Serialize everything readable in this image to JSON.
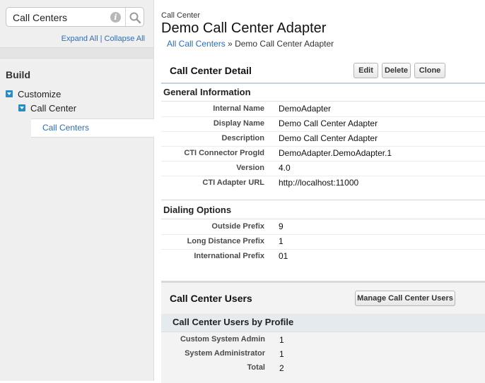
{
  "sidebar": {
    "search_value": "Call Centers",
    "expand_all": "Expand All",
    "separator": "|",
    "collapse_all": "Collapse All",
    "build_heading": "Build",
    "tree": {
      "customize": "Customize",
      "call_center": "Call Center",
      "call_centers": "Call Centers"
    }
  },
  "header": {
    "page_type": "Call Center",
    "title": "Demo Call Center Adapter",
    "breadcrumb_link": "All Call Centers",
    "breadcrumb_sep": "»",
    "breadcrumb_current": "Demo Call Center Adapter"
  },
  "detail": {
    "title": "Call Center Detail",
    "buttons": {
      "edit": "Edit",
      "delete": "Delete",
      "clone": "Clone"
    },
    "general_heading": "General Information",
    "general_fields": [
      {
        "label": "Internal Name",
        "value": "DemoAdapter"
      },
      {
        "label": "Display Name",
        "value": "Demo Call Center Adapter"
      },
      {
        "label": "Description",
        "value": "Demo Call Center Adapter"
      },
      {
        "label": "CTI Connector ProgId",
        "value": "DemoAdapter.DemoAdapter.1"
      },
      {
        "label": "Version",
        "value": "4.0"
      },
      {
        "label": "CTI Adapter URL",
        "value": "http://localhost:11000"
      }
    ],
    "dialing_heading": "Dialing Options",
    "dialing_fields": [
      {
        "label": "Outside Prefix",
        "value": "9"
      },
      {
        "label": "Long Distance Prefix",
        "value": "1"
      },
      {
        "label": "International Prefix",
        "value": "01"
      }
    ]
  },
  "users": {
    "title": "Call Center Users",
    "manage_button": "Manage Call Center Users",
    "by_profile_heading": "Call Center Users by Profile",
    "rows": [
      {
        "label": "Custom System Admin",
        "value": "1"
      },
      {
        "label": "System Administrator",
        "value": "1"
      },
      {
        "label": "Total",
        "value": "2"
      }
    ]
  },
  "colors": {
    "link": "#2a6ebb",
    "tree_toggle": "#2c8ac3",
    "section_rule": "#c3d3e2"
  }
}
